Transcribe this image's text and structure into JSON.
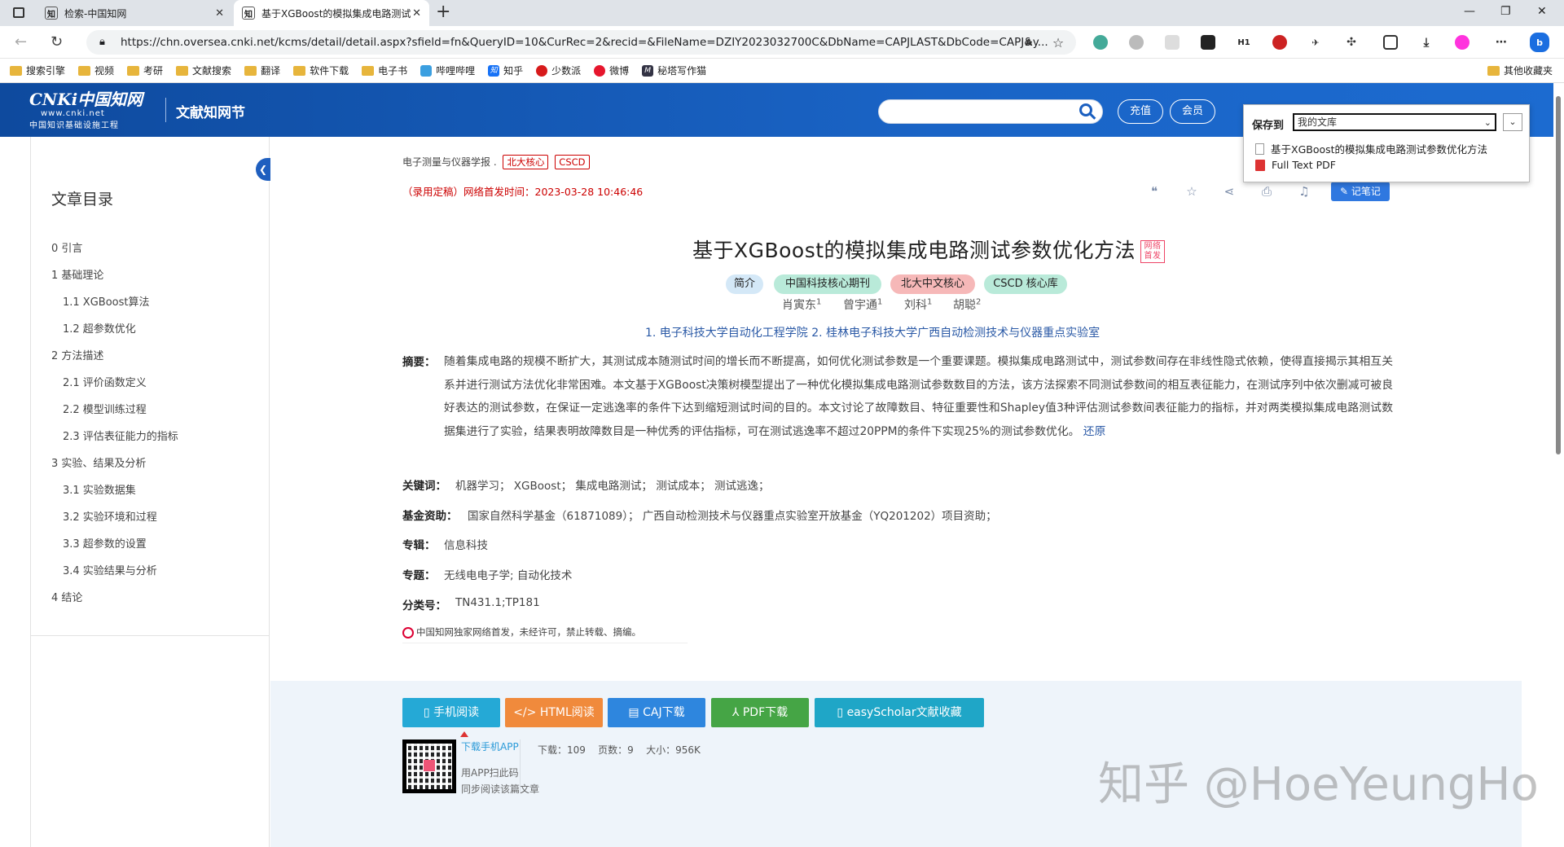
{
  "browser": {
    "tabs": [
      {
        "title": "检索-中国知网",
        "active": false
      },
      {
        "title": "基于XGBoost的模拟集成电路测试",
        "active": true
      }
    ],
    "new_tab": "+",
    "url": "https://chn.oversea.cnki.net/kcms/detail/detail.aspx?sfield=fn&QueryID=10&CurRec=2&recid=&FileName=DZIY2023032700C&DbName=CAPJLAST&DbCode=CAPJ&y...",
    "bookmarks": [
      "搜索引擎",
      "视频",
      "考研",
      "文献搜索",
      "翻译",
      "软件下载",
      "电子书",
      "哔哩哔哩",
      "知乎",
      "少数派",
      "微博",
      "秘塔写作猫"
    ],
    "other_bookmarks": "其他收藏夹"
  },
  "header": {
    "logo_main": "CNKi中国知网",
    "logo_url": "www.cnki.net",
    "logo_sub": "中国知识基础设施工程",
    "site_title": "文献知网节",
    "recharge": "充值",
    "member": "会员"
  },
  "toc": {
    "title": "文章目录",
    "items": [
      "0 引言",
      "1 基础理论",
      "1.1 XGBoost算法",
      "1.2 超参数优化",
      "2 方法描述",
      "2.1 评价函数定义",
      "2.2 模型训练过程",
      "2.3 评估表征能力的指标",
      "3 实验、结果及分析",
      "3.1 实验数据集",
      "3.2 实验环境和过程",
      "3.3 超参数的设置",
      "3.4 实验结果与分析",
      "4 结论"
    ]
  },
  "article": {
    "journal": "电子测量与仪器学报 .",
    "tags": [
      "北大核心",
      "CSCD"
    ],
    "online_first": "（录用定稿）网络首发时间：2023-03-28 10:46:46",
    "note_button": "记笔记",
    "title": "基于XGBoost的模拟集成电路测试参数优化方法",
    "title_badge": "网络首发",
    "pills": [
      "简介",
      "中国科技核心期刊",
      "北大中文核心",
      "CSCD 核心库"
    ],
    "authors": [
      {
        "name": "肖寅东",
        "sup": "1"
      },
      {
        "name": "曾宇通",
        "sup": "1"
      },
      {
        "name": "刘科",
        "sup": "1"
      },
      {
        "name": "胡聪",
        "sup": "2"
      }
    ],
    "affiliations": "1. 电子科技大学自动化工程学院   2. 桂林电子科技大学广西自动检测技术与仪器重点实验室",
    "abstract_label": "摘要：",
    "abstract": "随着集成电路的规模不断扩大，其测试成本随测试时间的增长而不断提高，如何优化测试参数是一个重要课题。模拟集成电路测试中，测试参数间存在非线性隐式依赖，使得直接揭示其相互关系并进行测试方法优化非常困难。本文基于XGBoost决策树模型提出了一种优化模拟集成电路测试参数数目的方法，该方法探索不同测试参数间的相互表征能力，在测试序列中依次删减可被良好表达的测试参数，在保证一定逃逸率的条件下达到缩短测试时间的目的。本文讨论了故障数目、特征重要性和Shapley值3种评估测试参数间表征能力的指标，并对两类模拟集成电路测试数据集进行了实验，结果表明故障数目是一种优秀的评估指标，可在测试逃逸率不超过20PPM的条件下实现25%的测试参数优化。",
    "restore": "还原",
    "keywords_label": "关键词：",
    "keywords": "机器学习；  XGBoost；  集成电路测试；  测试成本；  测试逃逸；",
    "funding_label": "基金资助：",
    "funding": "国家自然科学基金（61871089）；  广西自动检测技术与仪器重点实验室开放基金（YQ201202）项目资助；",
    "series_label": "专辑：",
    "series": "信息科技",
    "topic_label": "专题：",
    "topic": "无线电电子学; 自动化技术",
    "class_label": "分类号：",
    "class": "TN431.1;TP181",
    "exclusive": "中国知网独家网络首发，未经许可，禁止转载、摘编。"
  },
  "download": {
    "buttons": [
      "手机阅读",
      "HTML阅读",
      "CAJ下载",
      "PDF下载",
      "easyScholar文献收藏"
    ],
    "app_download": "下载手机APP",
    "app_scan": "用APP扫此码",
    "app_sync": "同步阅读该篇文章",
    "downloads": "下载：109",
    "pages": "页数：9",
    "size": "大小：956K"
  },
  "save_popup": {
    "label": "保存到",
    "selected": "我的文库",
    "options": [
      "基于XGBoost的模拟集成电路测试参数优化方法",
      "Full Text PDF"
    ]
  },
  "watermark": "知乎 @HoeYeungHo",
  "colors": {
    "cnki_blue": "#1a64c6",
    "tag_red": "#cc0000",
    "link_blue": "#2a59a6"
  }
}
